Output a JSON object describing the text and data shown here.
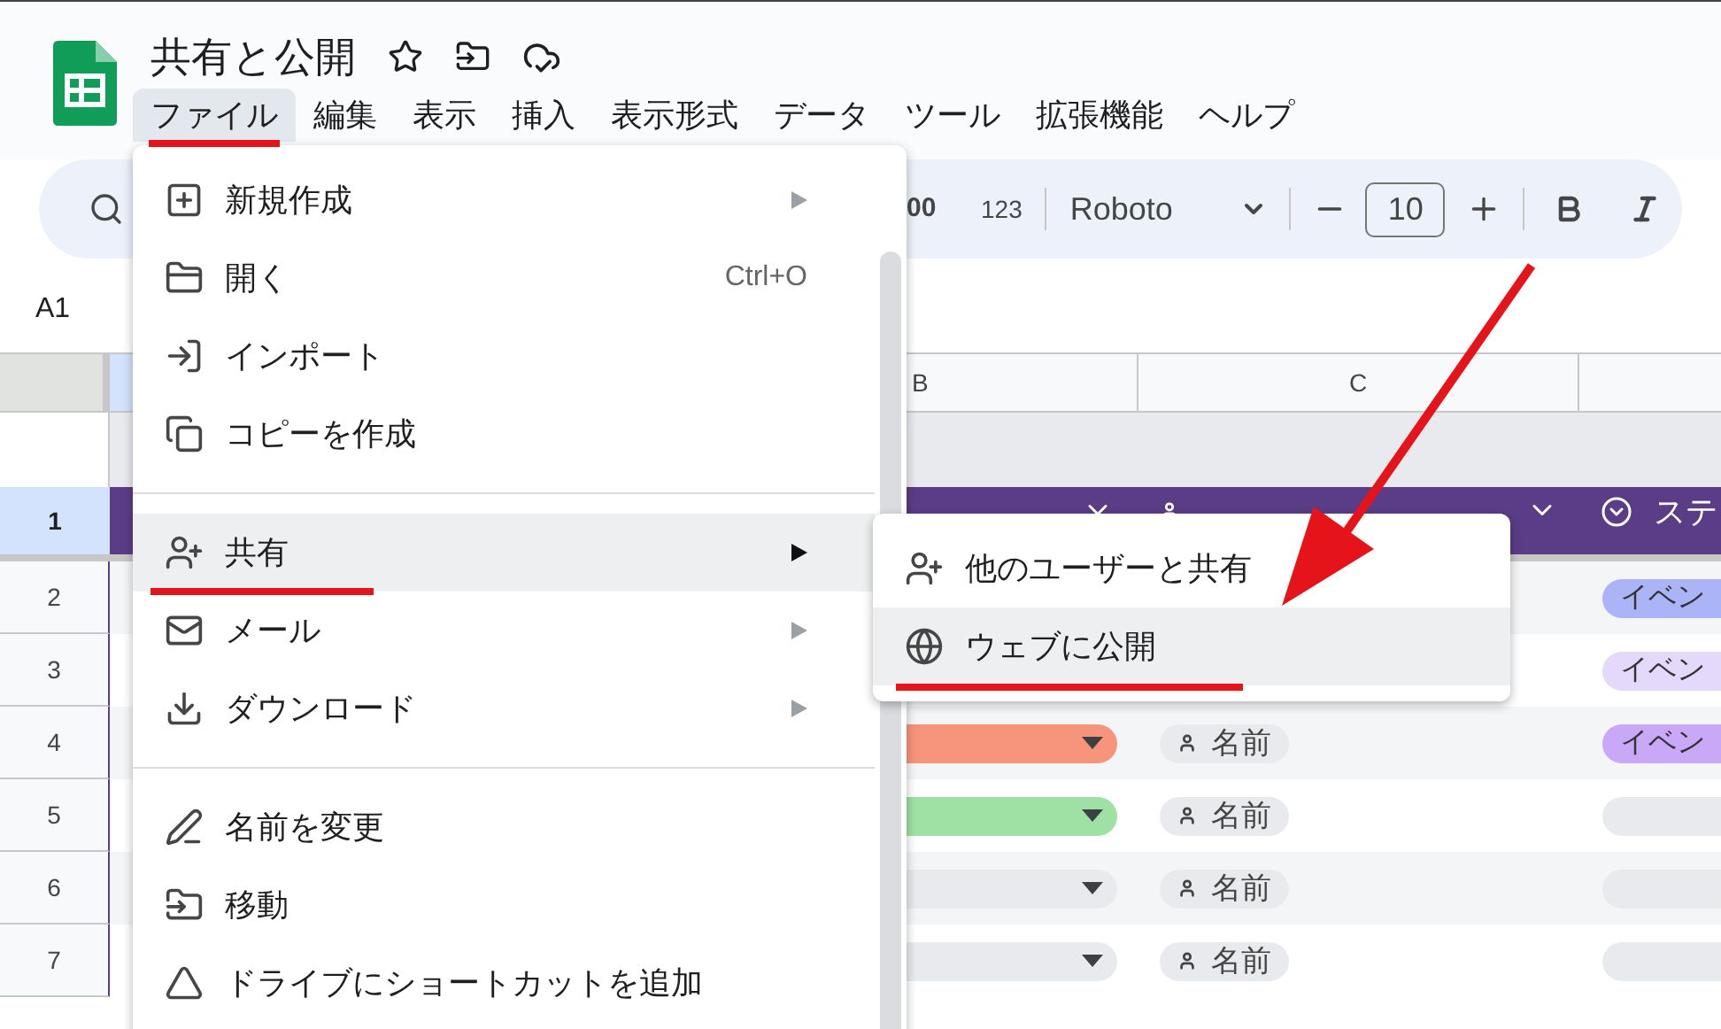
{
  "document": {
    "title": "共有と公開"
  },
  "menubar": [
    {
      "label": "ファイル",
      "selected": true,
      "underlined": true
    },
    {
      "label": "編集",
      "selected": false,
      "underlined": false
    },
    {
      "label": "表示",
      "selected": false,
      "underlined": false
    },
    {
      "label": "挿入",
      "selected": false,
      "underlined": false
    },
    {
      "label": "表示形式",
      "selected": false,
      "underlined": false
    },
    {
      "label": "データ",
      "selected": false,
      "underlined": false
    },
    {
      "label": "ツール",
      "selected": false,
      "underlined": false
    },
    {
      "label": "拡張機能",
      "selected": false,
      "underlined": false
    },
    {
      "label": "ヘルプ",
      "selected": false,
      "underlined": false
    }
  ],
  "toolbar": {
    "decimal": "00",
    "number_format": "123",
    "font": "Roboto",
    "font_size": "10"
  },
  "name_box": "A1",
  "columns": [
    "B",
    "C"
  ],
  "header_row": {
    "number": "1",
    "selected": true,
    "last_cell": "ステ"
  },
  "rows": [
    {
      "number": "2",
      "event": {
        "label": "イベン",
        "color": "#aab4f7"
      }
    },
    {
      "number": "3",
      "event": {
        "label": "イベン",
        "color": "#e4d9fb"
      }
    },
    {
      "number": "4",
      "status": {
        "color": "#f7947c"
      },
      "owner": "名前",
      "event": {
        "label": "イベン",
        "color": "#c9a9f7"
      }
    },
    {
      "number": "5",
      "status": {
        "color": "#9fe0a4"
      },
      "owner": "名前",
      "event": {
        "color": "#e8eaed"
      }
    },
    {
      "number": "6",
      "status": {
        "color": "#e8eaed"
      },
      "owner": "名前",
      "event": {
        "color": "#e8eaed"
      }
    },
    {
      "number": "7",
      "status": {
        "color": "#e8eaed"
      },
      "owner": "名前",
      "event": {
        "color": "#e8eaed"
      }
    }
  ],
  "file_menu": [
    {
      "kind": "item",
      "label": "新規作成",
      "submenu": true,
      "selected": false,
      "underlined": false
    },
    {
      "kind": "item",
      "label": "開く",
      "shortcut": "Ctrl+O",
      "submenu": false,
      "selected": false,
      "underlined": false
    },
    {
      "kind": "item",
      "label": "インポート",
      "submenu": false,
      "selected": false,
      "underlined": false
    },
    {
      "kind": "item",
      "label": "コピーを作成",
      "submenu": false,
      "selected": false,
      "underlined": false
    },
    {
      "kind": "divider"
    },
    {
      "kind": "item",
      "label": "共有",
      "submenu": true,
      "selected": true,
      "underlined": true
    },
    {
      "kind": "item",
      "label": "メール",
      "submenu": true,
      "selected": false,
      "underlined": false
    },
    {
      "kind": "item",
      "label": "ダウンロード",
      "submenu": true,
      "selected": false,
      "underlined": false
    },
    {
      "kind": "divider"
    },
    {
      "kind": "item",
      "label": "名前を変更",
      "submenu": false,
      "selected": false,
      "underlined": false
    },
    {
      "kind": "item",
      "label": "移動",
      "submenu": false,
      "selected": false,
      "underlined": false
    },
    {
      "kind": "item",
      "label": "ドライブにショートカットを追加",
      "submenu": false,
      "selected": false,
      "underlined": false
    }
  ],
  "share_submenu": [
    {
      "label": "他のユーザーと共有",
      "selected": false,
      "underlined": false
    },
    {
      "label": "ウェブに公開",
      "selected": true,
      "underlined": true
    }
  ]
}
